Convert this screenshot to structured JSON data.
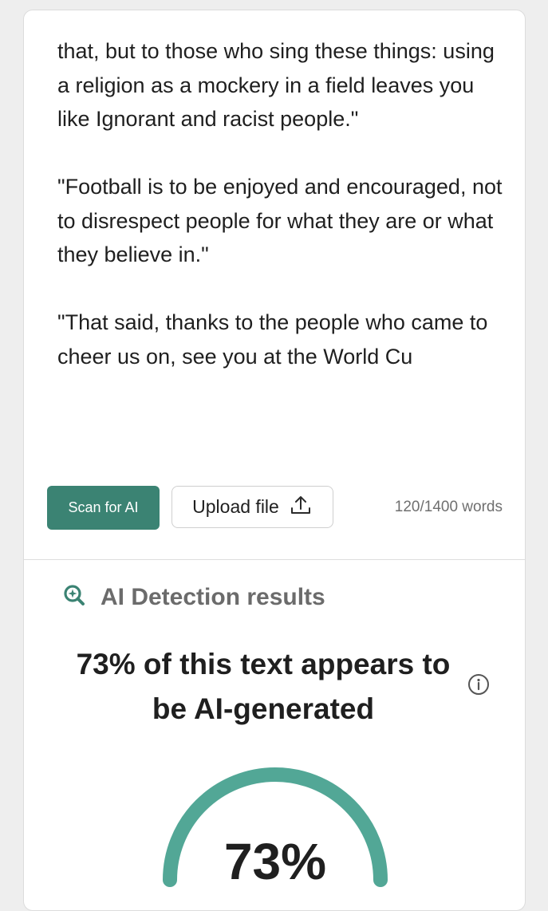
{
  "editor": {
    "paragraphs": [
      "that, but to those who sing these things: using a religion as a mockery in a field leaves you like Ignorant and racist people.\"",
      "\"Football is to be enjoyed and encouraged, not to disrespect people for what they are or what they believe in.\"",
      "\"That said, thanks to the people who came to cheer us on, see you at the World Cu"
    ]
  },
  "toolbar": {
    "scan_label": "Scan for AI",
    "upload_label": "Upload file",
    "word_count": "120/1400 words"
  },
  "results": {
    "title": "AI Detection results",
    "headline": "73% of this text appears to be AI-generated",
    "percent_label": "73%",
    "percent_value": 73
  },
  "colors": {
    "accent": "#3b8373",
    "gauge": "#52a796"
  },
  "icons": {
    "results": "magnifier-sparkle-icon",
    "upload": "upload-icon",
    "info": "info-icon"
  }
}
